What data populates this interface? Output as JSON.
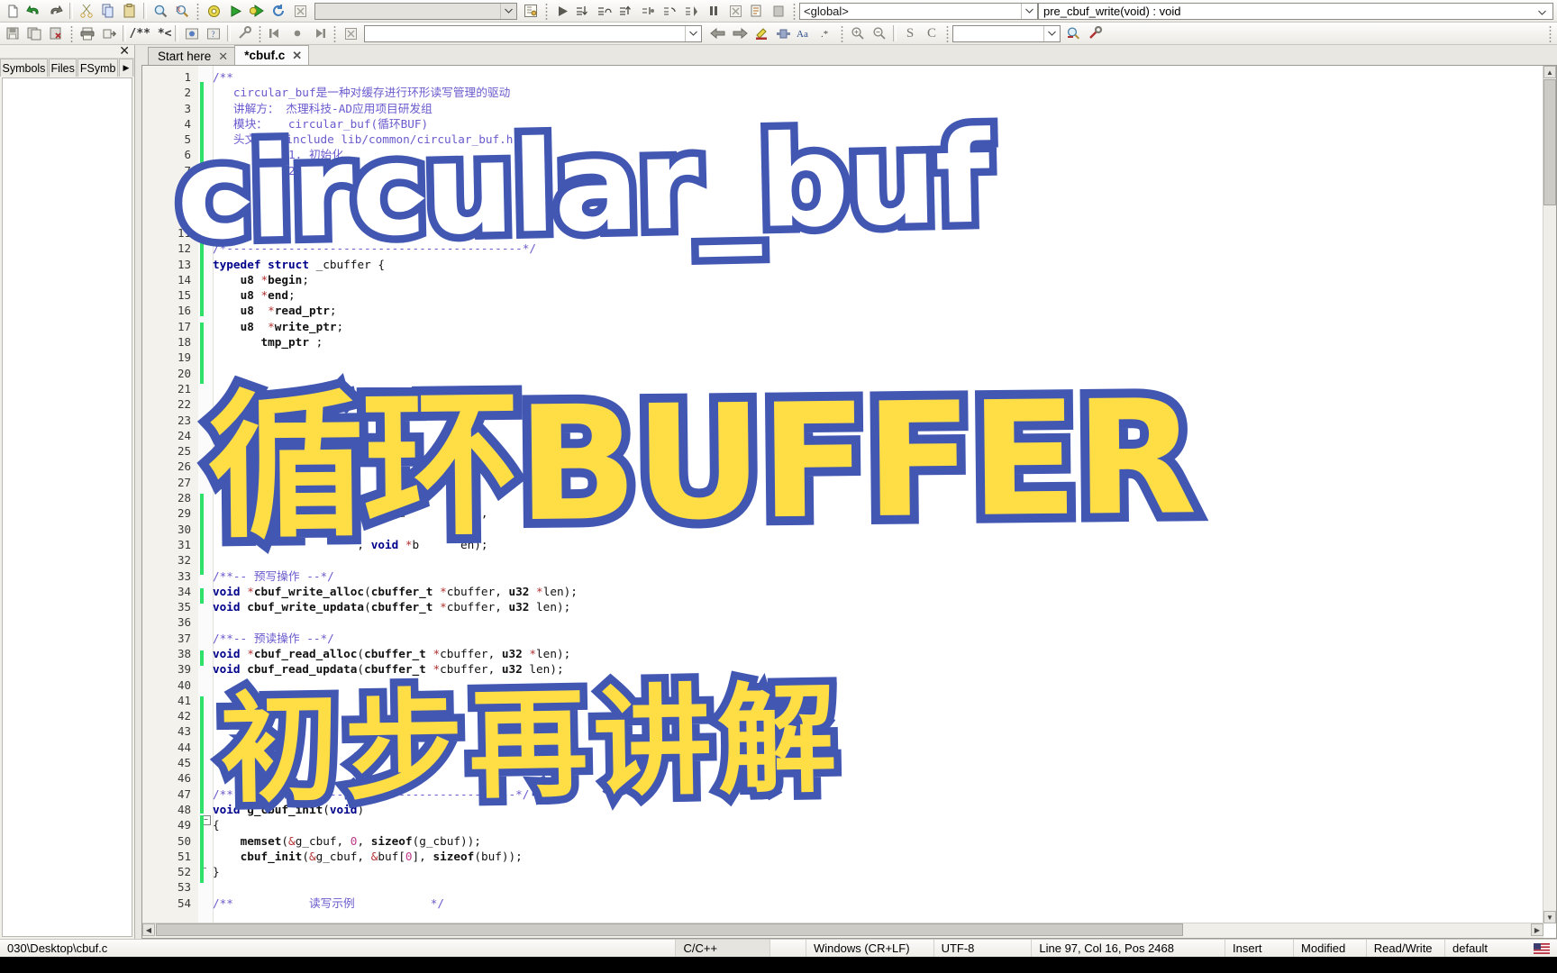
{
  "toolbar_top": {
    "buttons": [
      {
        "name": "new-icon",
        "glyph": "new"
      },
      {
        "name": "undo-icon",
        "glyph": "undo"
      },
      {
        "name": "redo-icon",
        "glyph": "redo"
      },
      {
        "name": "cut-icon",
        "glyph": "cut"
      },
      {
        "name": "copy-icon",
        "glyph": "copy"
      },
      {
        "name": "paste-icon",
        "glyph": "paste"
      },
      {
        "name": "find-icon",
        "glyph": "find"
      },
      {
        "name": "replace-icon",
        "glyph": "replace"
      },
      {
        "name": "build-icon",
        "glyph": "gear"
      },
      {
        "name": "run-icon",
        "glyph": "play"
      },
      {
        "name": "build-and-run-icon",
        "glyph": "playgear"
      },
      {
        "name": "rebuild-icon",
        "glyph": "refresh"
      },
      {
        "name": "abort-icon",
        "glyph": "stop"
      }
    ],
    "target_combo_value": "",
    "debug_buttons": [
      {
        "name": "debug-continue-icon"
      },
      {
        "name": "step-into-icon"
      },
      {
        "name": "step-over-icon"
      },
      {
        "name": "step-out-icon"
      },
      {
        "name": "next-instruction-icon"
      },
      {
        "name": "step-instruction-icon"
      },
      {
        "name": "run-to-cursor-icon"
      },
      {
        "name": "break-debugger-icon"
      },
      {
        "name": "stop-debugger-icon"
      }
    ],
    "scope_combo_value": "<global>",
    "symbol_field_value": "pre_cbuf_write(void) : void"
  },
  "toolbar_second": {
    "buttons": [
      {
        "name": "save-icon"
      },
      {
        "name": "save-all-icon"
      },
      {
        "name": "save-as-icon"
      },
      {
        "name": "print-icon"
      },
      {
        "name": "print-preview-icon"
      },
      {
        "name": "toggle-comment-icon",
        "label": "/** *<"
      },
      {
        "name": "bookmark-toggle-icon"
      },
      {
        "name": "bookmark-help-icon"
      },
      {
        "name": "settings-wrench-icon"
      },
      {
        "name": "jump-start-icon"
      },
      {
        "name": "bookmark-dot-icon"
      },
      {
        "name": "jump-end-icon"
      },
      {
        "name": "clear-bookmarks-icon"
      }
    ],
    "search_combo_value": "",
    "nav_buttons": [
      {
        "name": "nav-back-icon"
      },
      {
        "name": "nav-forward-icon"
      },
      {
        "name": "highlight-icon"
      },
      {
        "name": "selection-icon"
      },
      {
        "name": "match-case-icon"
      },
      {
        "name": "regex-icon"
      },
      {
        "name": "zoom-in-icon"
      },
      {
        "name": "zoom-out-icon"
      },
      {
        "name": "s-button",
        "label": "S"
      },
      {
        "name": "c-button",
        "label": "C"
      }
    ],
    "goto_combo_value": "",
    "tail_buttons": [
      {
        "name": "symbol-browse-icon"
      },
      {
        "name": "configure-icon"
      }
    ]
  },
  "dock": {
    "tabs": [
      {
        "name": "tab-symbols",
        "label": "Symbols"
      },
      {
        "name": "tab-files",
        "label": "Files"
      },
      {
        "name": "tab-fsymbols",
        "label": "FSymb"
      }
    ],
    "more_arrow": "▶",
    "close_glyph": "✕"
  },
  "editor": {
    "tabs": [
      {
        "name": "editor-tab-start-here",
        "label": "Start here",
        "active": false
      },
      {
        "name": "editor-tab-cbuf-c",
        "label": "*cbuf.c",
        "active": true
      }
    ],
    "close_glyph": "✕",
    "first_line_number": 1,
    "last_line_number": 54,
    "lines": [
      {
        "n": 1,
        "html": "<span class='cmt'>/**</span>"
      },
      {
        "n": 2,
        "html": "   <span class='cmt'>circular_buf是一种对缓存进行环形读写管理的驱动</span>"
      },
      {
        "n": 3,
        "html": "   <span class='cmt'>讲解方： 杰理科技-AD应用项目研发组</span>"
      },
      {
        "n": 4,
        "html": "   <span class='cmt'>模块：   circular_buf(循环BUF)</span>"
      },
      {
        "n": 5,
        "html": "   <span class='cmt'>头文件： include lib/common/circular_buf.h</span>"
      },
      {
        "n": 6,
        "html": "   <span class='cmt'>        1. 初始化</span>"
      },
      {
        "n": 7,
        "html": "   <span class='cmt'>        2. 读写</span>"
      },
      {
        "n": 8,
        "html": ""
      },
      {
        "n": 9,
        "html": ""
      },
      {
        "n": 10,
        "html": ""
      },
      {
        "n": 11,
        "html": ""
      },
      {
        "n": 12,
        "html": "<span class='cmt'>/*-------------------------------------------*/</span>"
      },
      {
        "n": 13,
        "html": "<span class='kw'>typedef</span> <span class='kw'>struct</span> _cbuffer {"
      },
      {
        "n": 14,
        "html": "    <span class='typ'>u8</span> <span class='op'>*</span><span class='typ'>begin</span>;"
      },
      {
        "n": 15,
        "html": "    <span class='typ'>u8</span> <span class='op'>*</span><span class='typ'>end</span>;"
      },
      {
        "n": 16,
        "html": "    <span class='typ'>u8</span>  <span class='op'>*</span><span class='typ'>read_ptr</span>;"
      },
      {
        "n": 17,
        "html": "    <span class='typ'>u8</span>  <span class='op'>*</span><span class='typ'>write_ptr</span>;"
      },
      {
        "n": 18,
        "html": "       <span class='typ'>tmp_ptr</span> ;"
      },
      {
        "n": 19,
        "html": ""
      },
      {
        "n": 20,
        "html": ""
      },
      {
        "n": 21,
        "html": ""
      },
      {
        "n": 22,
        "html": ""
      },
      {
        "n": 23,
        "html": ""
      },
      {
        "n": 24,
        "html": ""
      },
      {
        "n": 25,
        "html": ""
      },
      {
        "n": 26,
        "html": ""
      },
      {
        "n": 27,
        "html": "                         bu"
      },
      {
        "n": 28,
        "html": ""
      },
      {
        "n": 29,
        "html": "                          bu          n,"
      },
      {
        "n": 30,
        "html": ""
      },
      {
        "n": 31,
        "html": "                     , <span class='kw'>void</span> <span class='op'>*</span>b      en);"
      },
      {
        "n": 32,
        "html": ""
      },
      {
        "n": 33,
        "html": "<span class='cmt'>/**-- 预写操作 --*/</span>"
      },
      {
        "n": 34,
        "html": "<span class='kw'>void</span> <span class='op'>*</span><span class='fn'>cbuf_write_alloc</span>(<span class='typ'>cbuffer_t</span> <span class='op'>*</span>cbuffer, <span class='typ'>u32</span> <span class='op'>*</span>len);"
      },
      {
        "n": 35,
        "html": "<span class='kw'>void</span> <span class='fn'>cbuf_write_updata</span>(<span class='typ'>cbuffer_t</span> <span class='op'>*</span>cbuffer, <span class='typ'>u32</span> len);"
      },
      {
        "n": 36,
        "html": ""
      },
      {
        "n": 37,
        "html": "<span class='cmt'>/**-- 预读操作 --*/</span>"
      },
      {
        "n": 38,
        "html": "<span class='kw'>void</span> <span class='op'>*</span><span class='fn'>cbuf_read_alloc</span>(<span class='typ'>cbuffer_t</span> <span class='op'>*</span>cbuffer, <span class='typ'>u32</span> <span class='op'>*</span>len);"
      },
      {
        "n": 39,
        "html": "<span class='kw'>void</span> <span class='fn'>cbuf_read_updata</span>(<span class='typ'>cbuffer_t</span> <span class='op'>*</span>cbuffer, <span class='typ'>u32</span> len);"
      },
      {
        "n": 40,
        "html": ""
      },
      {
        "n": 41,
        "html": ""
      },
      {
        "n": 42,
        "html": ""
      },
      {
        "n": 43,
        "html": ""
      },
      {
        "n": 44,
        "html": ""
      },
      {
        "n": 45,
        "html": ""
      },
      {
        "n": 46,
        "html": ""
      },
      {
        "n": 47,
        "html": "<span class='cmt'>/**-----------------------------------------*/</span>"
      },
      {
        "n": 48,
        "html": "<span class='kw'>void</span> <span class='fn'>g_cbuf_init</span>(<span class='kw'>void</span>)"
      },
      {
        "n": 49,
        "html": "{"
      },
      {
        "n": 50,
        "html": "    <span class='fn'>memset</span>(<span class='op'>&amp;</span>g_cbuf, <span class='num'>0</span>, <span class='fn'>sizeof</span>(g_cbuf));"
      },
      {
        "n": 51,
        "html": "    <span class='fn'>cbuf_init</span>(<span class='op'>&amp;</span>g_cbuf, <span class='op'>&amp;</span>buf[<span class='num'>0</span>], <span class='fn'>sizeof</span>(buf));"
      },
      {
        "n": 52,
        "html": "}"
      },
      {
        "n": 53,
        "html": ""
      },
      {
        "n": 54,
        "html": "<span class='cmt'>/**           读写示例           */</span>"
      }
    ]
  },
  "statusbar": {
    "file_path": "030\\Desktop\\cbuf.c",
    "language": "C/C++",
    "line_ending": "Windows (CR+LF)",
    "encoding": "UTF-8",
    "caret": "Line 97, Col 16, Pos 2468",
    "insert_mode": "Insert",
    "modified": "Modified",
    "access": "Read/Write",
    "profile": "default"
  },
  "overlay": {
    "title_latin": "circular_buf",
    "title_cjk": "循环BUFFER",
    "subtitle_cjk": "初步再讲解",
    "outline_color": "#4257b2",
    "fill_yellow": "#ffdd44",
    "fill_white": "#ffffff"
  }
}
